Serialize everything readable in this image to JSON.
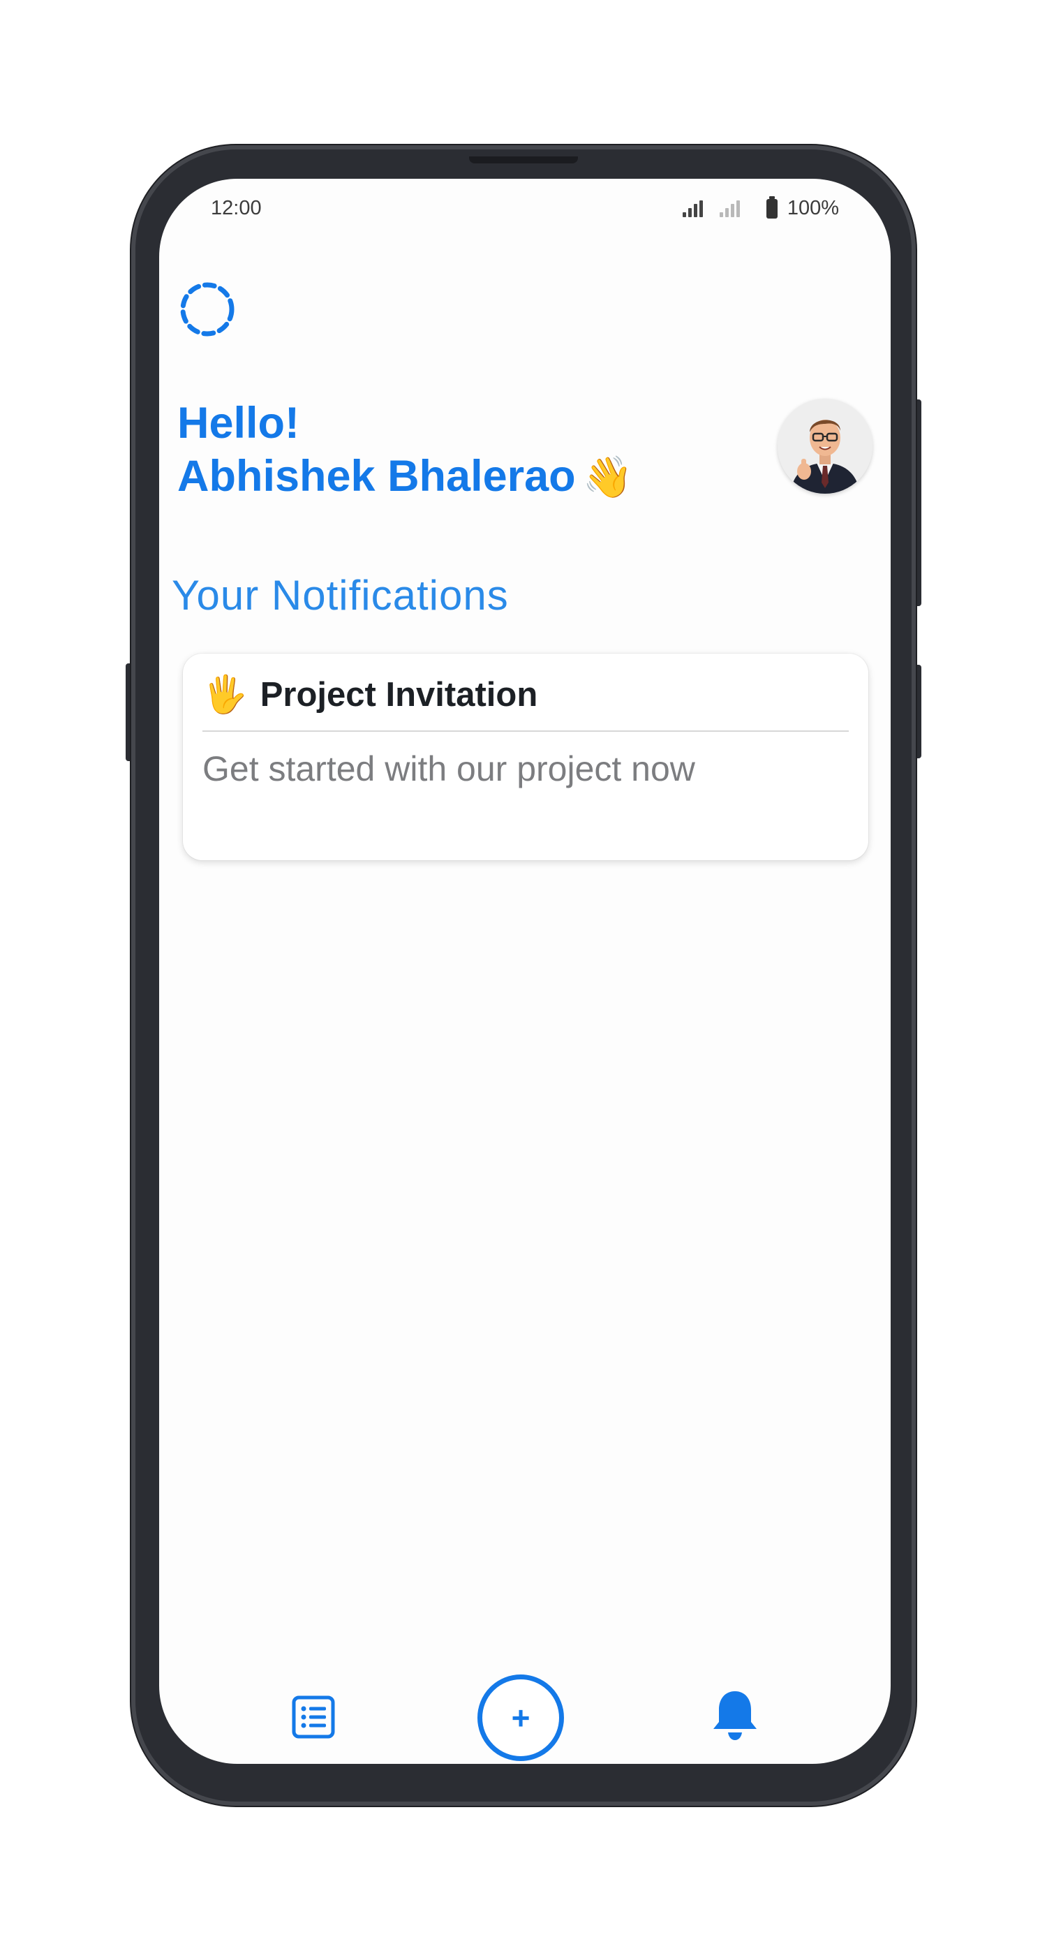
{
  "status_bar": {
    "time": "12:00",
    "battery": "100%"
  },
  "header": {
    "greeting_line1": "Hello!",
    "greeting_name": "Abhishek Bhalerao",
    "wave_emoji": "👋",
    "avatar_icon": "avatar-businessman"
  },
  "notifications": {
    "title": "Your Notifications",
    "items": [
      {
        "emoji": "🖐",
        "title": "Project Invitation",
        "body": "Get started with our project now"
      }
    ]
  },
  "bottom_nav": {
    "list_icon": "list-icon",
    "add_label": "+",
    "bell_icon": "bell-icon"
  },
  "colors": {
    "accent": "#1479e8",
    "title_text": "#1c2025",
    "muted_text": "#7c7d80"
  }
}
